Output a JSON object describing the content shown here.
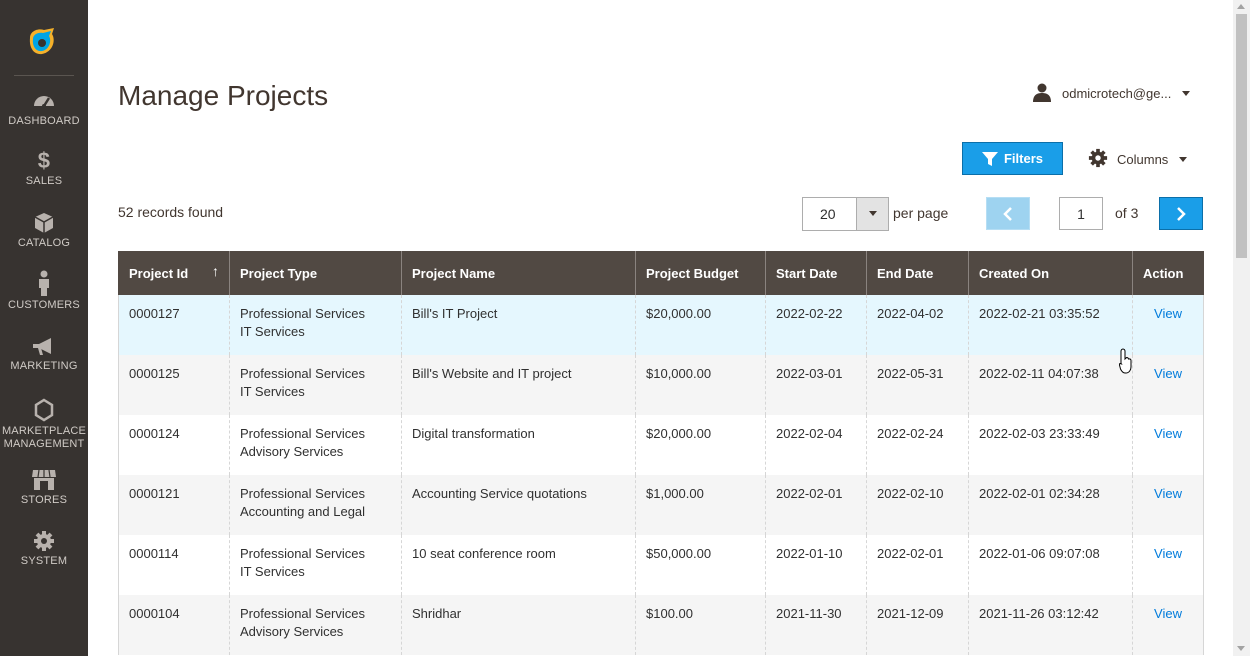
{
  "sidebar": {
    "items": [
      {
        "label": "DASHBOARD",
        "icon": "dashboard-icon"
      },
      {
        "label": "SALES",
        "icon": "dollar-icon"
      },
      {
        "label": "CATALOG",
        "icon": "box-icon"
      },
      {
        "label": "CUSTOMERS",
        "icon": "person-icon"
      },
      {
        "label": "MARKETING",
        "icon": "megaphone-icon"
      },
      {
        "label": "MARKETPLACE MANAGEMENT",
        "icon": "hexagon-icon"
      },
      {
        "label": "STORES",
        "icon": "storefront-icon"
      },
      {
        "label": "SYSTEM",
        "icon": "gear-icon"
      }
    ]
  },
  "header": {
    "title": "Manage Projects",
    "user": "odmicrotech@ge..."
  },
  "toolbar": {
    "filters_label": "Filters",
    "columns_label": "Columns"
  },
  "pager": {
    "records_found": "52 records found",
    "per_page_value": "20",
    "per_page_label": "per page",
    "current_page": "1",
    "of_pages": "of 3"
  },
  "table": {
    "columns": [
      "Project Id",
      "Project Type",
      "Project Name",
      "Project Budget",
      "Start Date",
      "End Date",
      "Created On",
      "Action"
    ],
    "sort_indicator": "↑",
    "rows": [
      {
        "id": "0000127",
        "type_line1": "Professional Services",
        "type_line2": "IT Services",
        "name": "Bill's IT Project",
        "budget": "$20,000.00",
        "start": "2022-02-22",
        "end": "2022-04-02",
        "created": "2022-02-21 03:35:52",
        "action": "View"
      },
      {
        "id": "0000125",
        "type_line1": "Professional Services",
        "type_line2": "IT Services",
        "name": "Bill's Website and IT project",
        "budget": "$10,000.00",
        "start": "2022-03-01",
        "end": "2022-05-31",
        "created": "2022-02-11 04:07:38",
        "action": "View"
      },
      {
        "id": "0000124",
        "type_line1": "Professional Services",
        "type_line2": "Advisory Services",
        "name": "Digital transformation",
        "budget": "$20,000.00",
        "start": "2022-02-04",
        "end": "2022-02-24",
        "created": "2022-02-03 23:33:49",
        "action": "View"
      },
      {
        "id": "0000121",
        "type_line1": "Professional Services",
        "type_line2": "Accounting and Legal",
        "name": "Accounting Service quotations",
        "budget": "$1,000.00",
        "start": "2022-02-01",
        "end": "2022-02-10",
        "created": "2022-02-01 02:34:28",
        "action": "View"
      },
      {
        "id": "0000114",
        "type_line1": "Professional Services",
        "type_line2": "IT Services",
        "name": "10 seat conference room",
        "budget": "$50,000.00",
        "start": "2022-01-10",
        "end": "2022-02-01",
        "created": "2022-01-06 09:07:08",
        "action": "View"
      },
      {
        "id": "0000104",
        "type_line1": "Professional Services",
        "type_line2": "Advisory Services",
        "name": "Shridhar",
        "budget": "$100.00",
        "start": "2021-11-30",
        "end": "2021-12-09",
        "created": "2021-11-26 03:12:42",
        "action": "View"
      }
    ]
  },
  "colors": {
    "sidebar_bg": "#373330",
    "header_bg": "#514943",
    "accent_blue": "#1a9ee8",
    "link_blue": "#007bdb",
    "hover_row": "#e5f7fe"
  }
}
